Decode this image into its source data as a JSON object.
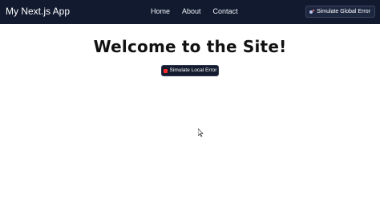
{
  "navbar": {
    "app_title": "My Next.js App",
    "links": [
      "Home",
      "About",
      "Contact"
    ],
    "global_error_label": "Simulate Global Error"
  },
  "main": {
    "headline": "Welcome to the Site!",
    "local_error_label": "Simulate Local Error"
  },
  "icons": {
    "global_error": "bomb-icon",
    "local_error": "red-square-icon",
    "cursor": "mouse-pointer-icon"
  },
  "colors": {
    "navbar_bg": "#121a2f",
    "button_bg": "#141b2e",
    "accent_red": "#ff2b2b"
  }
}
